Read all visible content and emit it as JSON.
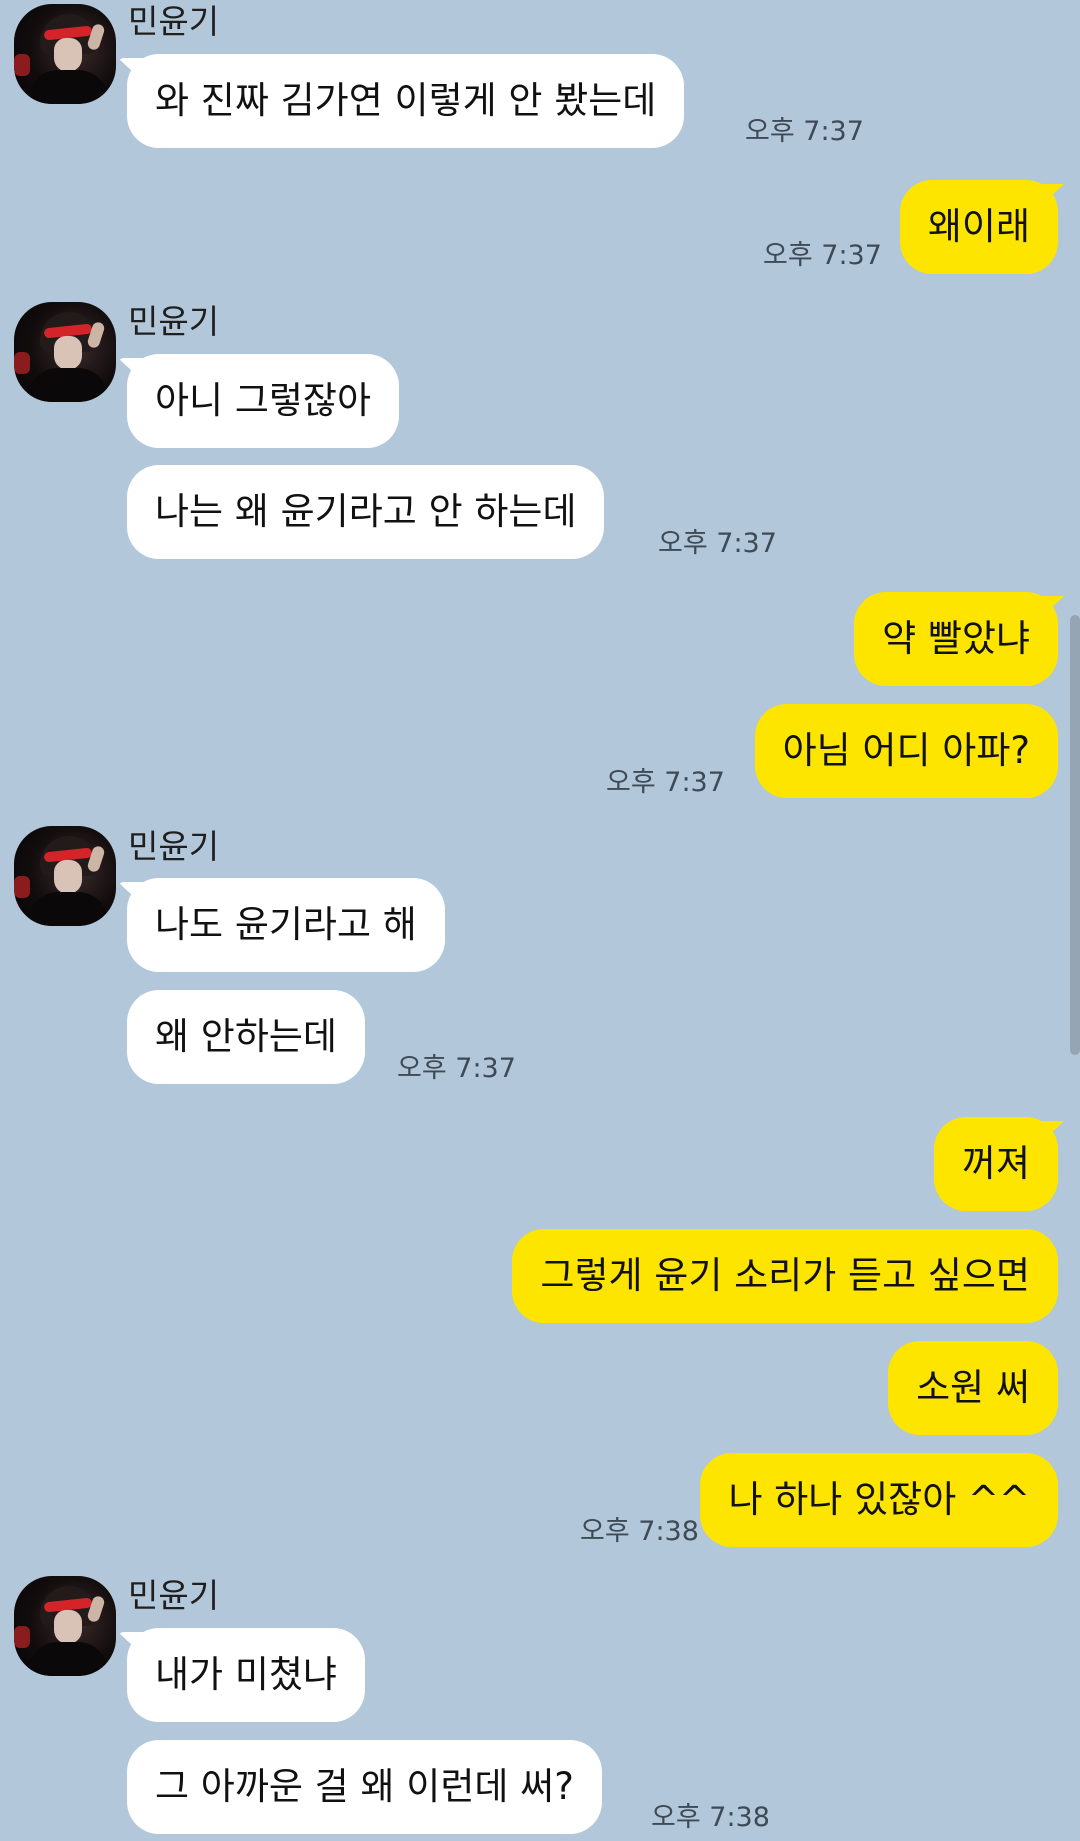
{
  "chat": {
    "sender_name": "민윤기",
    "colors": {
      "background": "#b2c7da",
      "incoming_bubble": "#ffffff",
      "outgoing_bubble": "#fee500"
    },
    "groups": [
      {
        "direction": "in",
        "name": "민윤기",
        "messages": [
          "와 진짜 김가연 이렇게 안 봤는데"
        ],
        "time": "오후 7:37"
      },
      {
        "direction": "out",
        "messages": [
          "왜이래"
        ],
        "time": "오후 7:37"
      },
      {
        "direction": "in",
        "name": "민윤기",
        "messages": [
          "아니 그렇잖아",
          "나는 왜 윤기라고 안 하는데"
        ],
        "time": "오후 7:37"
      },
      {
        "direction": "out",
        "messages": [
          "약 빨았냐",
          "아님 어디 아파?"
        ],
        "time": "오후 7:37"
      },
      {
        "direction": "in",
        "name": "민윤기",
        "messages": [
          "나도 윤기라고 해",
          "왜 안하는데"
        ],
        "time": "오후 7:37"
      },
      {
        "direction": "out",
        "messages": [
          "꺼져",
          "그렇게 윤기 소리가 듣고 싶으면",
          "소원 써",
          "나 하나 있잖아 ^^"
        ],
        "time": "오후 7:38"
      },
      {
        "direction": "in",
        "name": "민윤기",
        "messages": [
          "내가 미쳤냐",
          "그 아까운 걸 왜 이런데 써?"
        ],
        "time": "오후 7:38"
      }
    ]
  }
}
